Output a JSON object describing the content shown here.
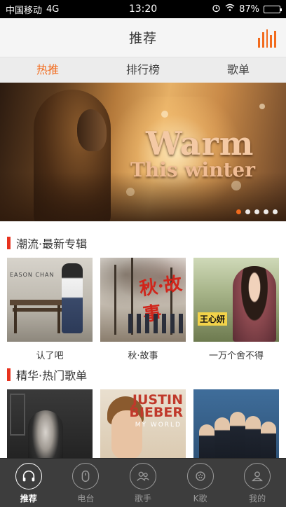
{
  "status_bar": {
    "carrier": "中国移动",
    "network": "4G",
    "time": "13:20",
    "battery_percent": "87%",
    "battery_level": 0.87
  },
  "nav": {
    "title": "推荐",
    "menu_icon": "equalizer-icon",
    "accent_color": "#f26b1d"
  },
  "tabs": [
    {
      "label": "热推",
      "active": true
    },
    {
      "label": "排行榜",
      "active": false
    },
    {
      "label": "歌单",
      "active": false
    }
  ],
  "banner": {
    "line1": "Warm",
    "line2": "This winter",
    "page_count": 5,
    "active_index": 0
  },
  "sections": [
    {
      "title": "潮流·最新专辑",
      "items": [
        {
          "label": "认了吧",
          "cover_text": "EASON CHAN"
        },
        {
          "label": "秋·故事",
          "cover_text": "秋·故事"
        },
        {
          "label": "一万个舍不得",
          "cover_text": "王心妍"
        }
      ]
    },
    {
      "title": "精华·热门歌单",
      "items": [
        {
          "label": ""
        },
        {
          "label": "",
          "cover_text": "JUSTIN BIEBER",
          "cover_sub": "MY WORLD"
        },
        {
          "label": ""
        }
      ]
    }
  ],
  "bottom_tabs": [
    {
      "label": "推荐",
      "icon": "headphones-icon",
      "active": true
    },
    {
      "label": "电台",
      "icon": "radio-icon",
      "active": false
    },
    {
      "label": "歌手",
      "icon": "singers-icon",
      "active": false
    },
    {
      "label": "K歌",
      "icon": "karaoke-icon",
      "active": false
    },
    {
      "label": "我的",
      "icon": "profile-icon",
      "active": false
    }
  ]
}
